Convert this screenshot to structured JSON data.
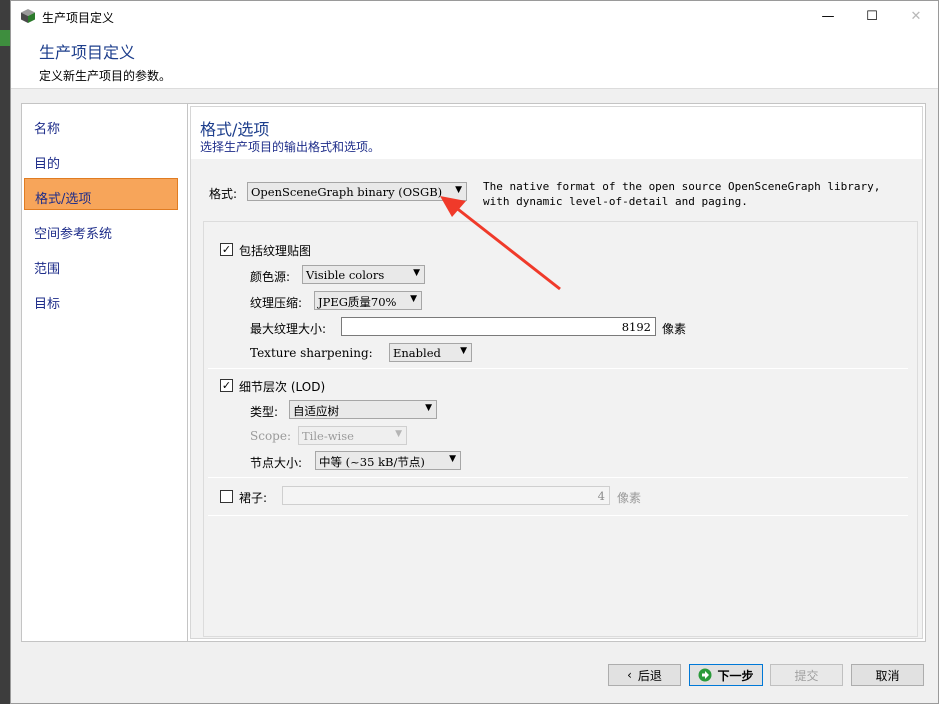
{
  "window": {
    "title": "生产项目定义",
    "minimize_glyph": "—",
    "maximize_glyph": "☐",
    "close_glyph": "✕"
  },
  "header": {
    "title": "生产项目定义",
    "subtitle": "定义新生产项目的参数。"
  },
  "nav": {
    "items": [
      {
        "label": "名称",
        "active": false
      },
      {
        "label": "目的",
        "active": false
      },
      {
        "label": "格式/选项",
        "active": true
      },
      {
        "label": "空间参考系统",
        "active": false
      },
      {
        "label": "范围",
        "active": false
      },
      {
        "label": "目标",
        "active": false
      }
    ]
  },
  "section": {
    "title": "格式/选项",
    "subtitle": "选择生产项目的输出格式和选项。"
  },
  "format": {
    "label": "格式:",
    "value": "OpenSceneGraph binary (OSGB)",
    "description_line1": "The native format of the open source OpenSceneGraph library,",
    "description_line2": "with dynamic level-of-detail and paging."
  },
  "texture": {
    "checkbox_label": "包括纹理贴图",
    "checked": true,
    "color_source_label": "颜色源:",
    "color_source_value": "Visible colors",
    "compression_label": "纹理压缩:",
    "compression_value": "JPEG质量70%",
    "max_size_label": "最大纹理大小:",
    "max_size_value": "8192",
    "max_size_unit": "像素",
    "sharpening_label": "Texture sharpening:",
    "sharpening_value": "Enabled"
  },
  "lod": {
    "checkbox_label": "细节层次 (LOD)",
    "checked": true,
    "type_label": "类型:",
    "type_value": "自适应树",
    "scope_label": "Scope:",
    "scope_value": "Tile-wise",
    "node_size_label": "节点大小:",
    "node_size_value": "中等 (~35 kB/节点)"
  },
  "skirt": {
    "checkbox_label": "裙子:",
    "checked": false,
    "value": "4",
    "unit": "像素"
  },
  "buttons": {
    "back": "后退",
    "next": "下一步",
    "submit": "提交",
    "cancel": "取消"
  },
  "colors": {
    "accent_title": "#1d3e8c",
    "nav_active": "#f7a55a",
    "annotation_arrow": "#f03a2a"
  }
}
